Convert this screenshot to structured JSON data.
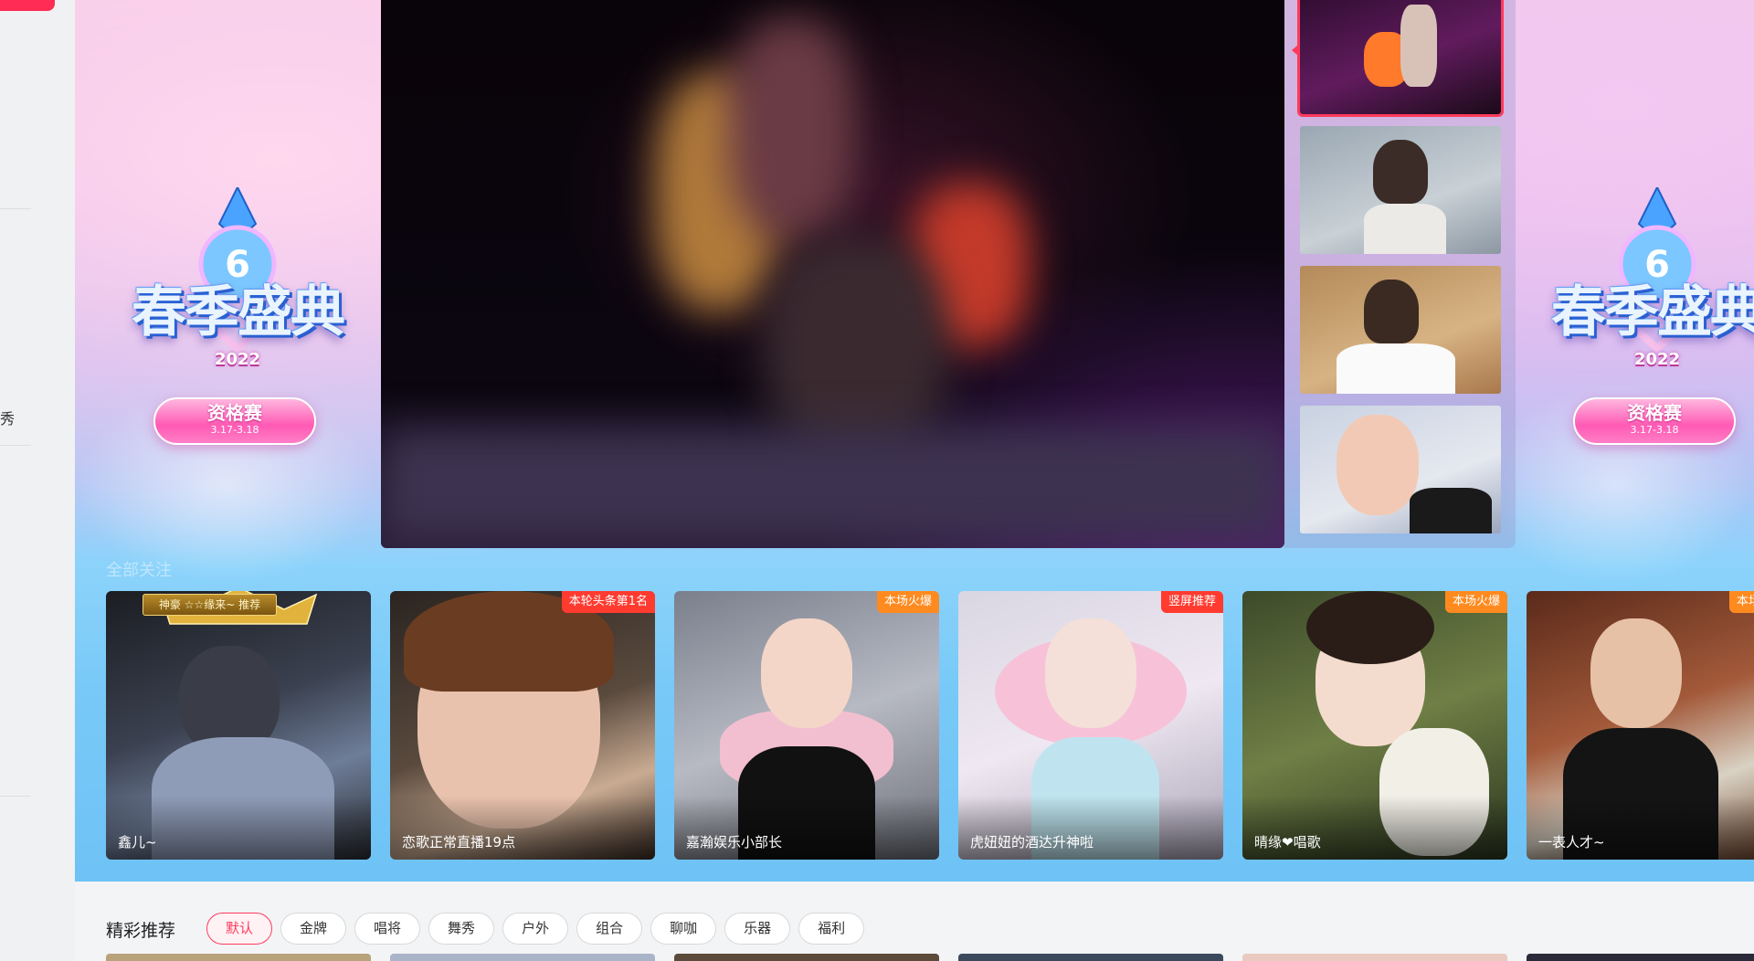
{
  "sidebar": {
    "nav_fragment": "秀"
  },
  "banner": {
    "event_logo": {
      "title": "春季盛典",
      "year": "2022",
      "button_label": "资格赛",
      "button_date": "3.17-3.18"
    },
    "carousel_title": "全部关注"
  },
  "rooms": [
    {
      "name": "鑫儿~",
      "top_label": "神豪 ☆☆缘来~ 推荐",
      "badge": ""
    },
    {
      "name": "恋歌正常直播19点",
      "badge": "本轮头条第1名"
    },
    {
      "name": "嘉瀚娱乐小部长",
      "badge": "本场火爆"
    },
    {
      "name": "虎妞妞的酒达升神啦",
      "badge": "竖屏推荐"
    },
    {
      "name": "晴缘❤唱歌",
      "badge": "本场火爆"
    },
    {
      "name": "一表人才~",
      "badge": "本场火爆"
    }
  ],
  "section": {
    "title": "精彩推荐",
    "filters": [
      "默认",
      "金牌",
      "唱将",
      "舞秀",
      "户外",
      "组合",
      "聊咖",
      "乐器",
      "福利"
    ],
    "active_filter": "默认"
  },
  "colors": {
    "accent": "#ff3b5c",
    "badge_red": "#ff3b30",
    "badge_orange": "#ff8a1f"
  }
}
